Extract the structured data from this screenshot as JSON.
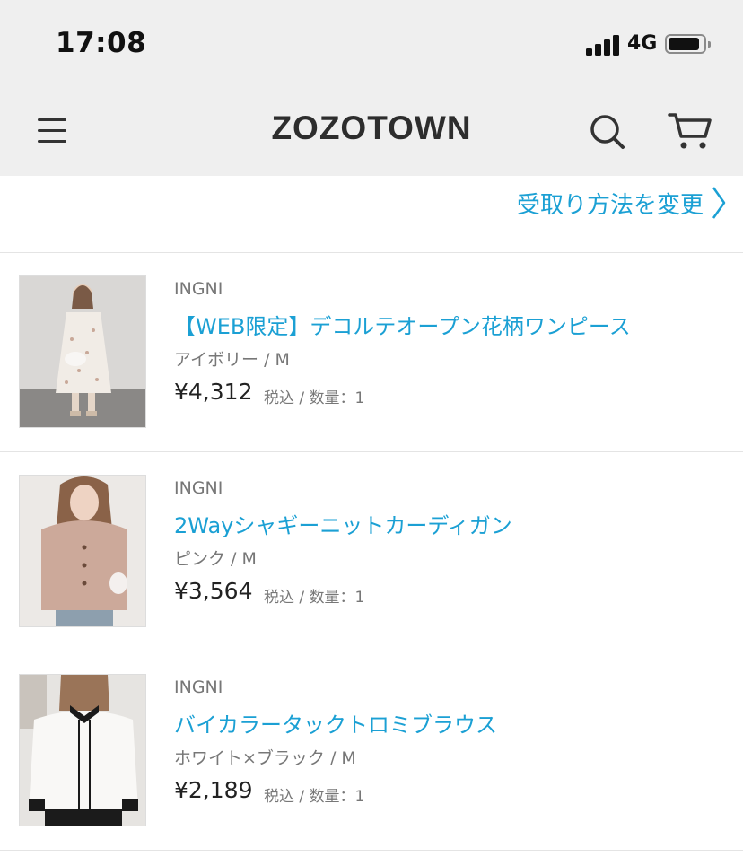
{
  "status": {
    "time": "17:08",
    "network": "4G"
  },
  "header": {
    "logo": "ZOZOTOWN"
  },
  "pickup": {
    "label": "受取り方法を変更"
  },
  "items": [
    {
      "brand": "INGNI",
      "title": "【WEB限定】デコルテオープン花柄ワンピース",
      "variant": "アイボリー / M",
      "price": "¥4,312",
      "meta": "税込 / 数量：1"
    },
    {
      "brand": "INGNI",
      "title": "2Wayシャギーニットカーディガン",
      "variant": "ピンク / M",
      "price": "¥3,564",
      "meta": "税込 / 数量：1"
    },
    {
      "brand": "INGNI",
      "title": "バイカラータックトロミブラウス",
      "variant": "ホワイト×ブラック / M",
      "price": "¥2,189",
      "meta": "税込 / 数量：1"
    }
  ],
  "colors": {
    "link": "#1ba0d4",
    "header_bg": "#efefef",
    "text": "#333333",
    "muted": "#777777"
  },
  "icons": [
    "signal-icon",
    "battery-icon",
    "menu-icon",
    "search-icon",
    "cart-icon",
    "chevron-right-icon"
  ]
}
